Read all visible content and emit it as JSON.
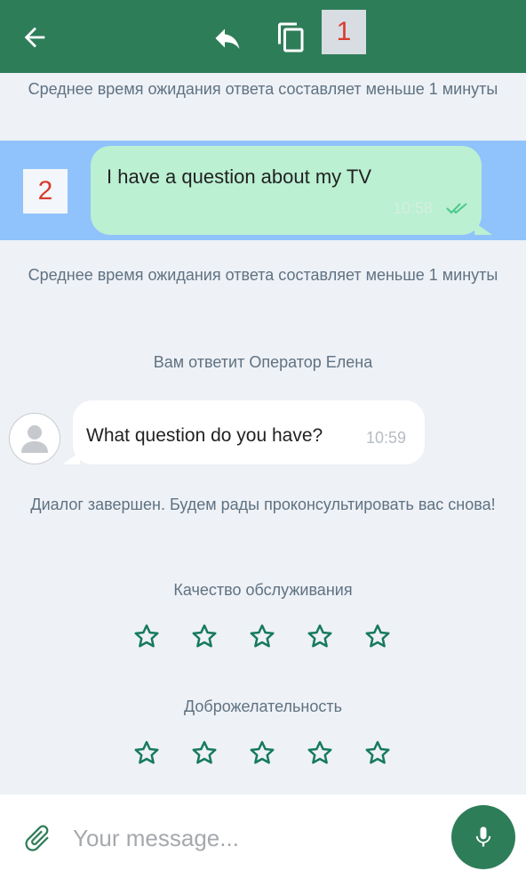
{
  "header": {
    "selection_count": "1"
  },
  "messages": {
    "wait_notice_1": "Среднее время ожидания ответа составляет меньше 1 минуты",
    "selected_marker": "2",
    "outgoing": {
      "text": "I have a question about my TV",
      "time": "10:58"
    },
    "wait_notice_2": "Среднее время ожидания ответа составляет меньше 1 минуты",
    "operator_notice": "Вам ответит Оператор Елена",
    "incoming": {
      "text": "What question do you have?",
      "time": "10:59"
    },
    "dialog_finished": "Диалог завершен. Будем рады проконсультировать вас снова!"
  },
  "rating": {
    "quality_label": "Качество обслуживания",
    "quality_stars": 0,
    "friendliness_label": "Доброжелательность",
    "friendliness_stars": 0
  },
  "composer": {
    "placeholder": "Your message..."
  },
  "colors": {
    "header": "#2e7d59",
    "selection": "#90c3fb",
    "outgoing_bubble": "#bbf0d2",
    "star_outline": "#157a5c"
  }
}
